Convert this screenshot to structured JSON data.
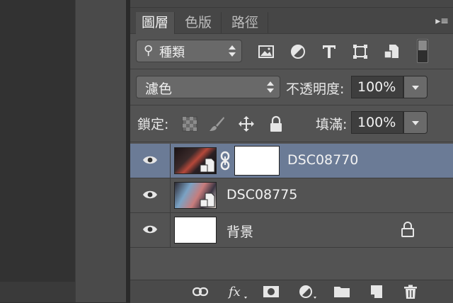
{
  "layers_panel": {
    "tabs": [
      {
        "label": "圖層",
        "active": true
      },
      {
        "label": "色版",
        "active": false
      },
      {
        "label": "路徑",
        "active": false
      }
    ],
    "filter": {
      "label": "種類",
      "icon": "magnifier-icon"
    },
    "blend_mode": "濾色",
    "opacity_label": "不透明度:",
    "opacity_value": "100%",
    "lock_label": "鎖定:",
    "fill_label": "填滿:",
    "fill_value": "100%",
    "layers": [
      {
        "name": "DSC08770",
        "selected": true,
        "has_mask": true,
        "locked": false
      },
      {
        "name": "DSC08775",
        "selected": false,
        "has_mask": false,
        "locked": false
      },
      {
        "name": "背景",
        "selected": false,
        "has_mask": false,
        "locked": true
      }
    ]
  },
  "colors": {
    "panel_bg": "#535353",
    "selected_layer": "#6b7b96"
  }
}
